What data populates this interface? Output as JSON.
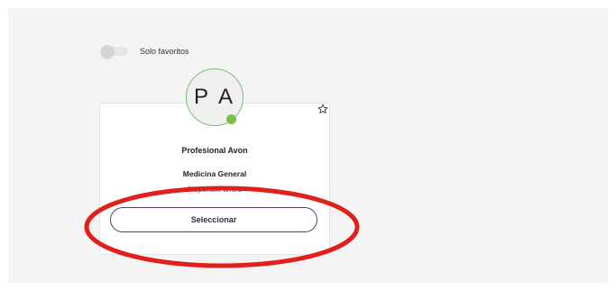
{
  "filters": {
    "favorites_label": "Solo favoritos"
  },
  "card": {
    "initials": "P A",
    "name": "Profesional Avon",
    "specialty": "Medicina General",
    "availability": "Disponible ahora",
    "select_label": "Seleccionar",
    "status_color": "#7ac143",
    "favorite_icon": "star-outline-icon"
  },
  "colors": {
    "button_border": "#5a4066",
    "annotation": "#e0201b"
  }
}
